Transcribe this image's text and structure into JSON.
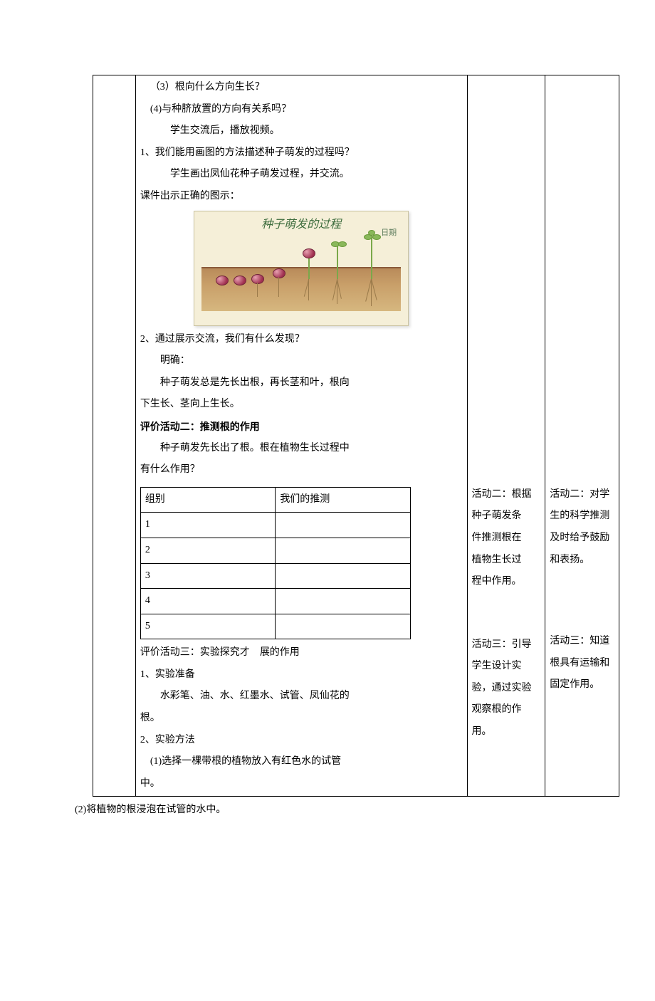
{
  "mid_top": {
    "q3": "（3）根向什么方向生长？",
    "q4": "(4)与种脐放置的方向有关系吗？",
    "line_a": "学生交流后，播放视频。",
    "num1": "1、我们能用画图的方法描述种子萌发的过程吗？",
    "line_b": "学生画出凤仙花种子萌发过程，并交流。",
    "line_c": "课件出示正确的图示：",
    "illus_title": "种子萌发的过程",
    "illus_date": "日期",
    "num2": "2、通过展示交流，我们有什么发现？",
    "line_d": "明确：",
    "line_e": "种子萌发总是先长出根，再长茎和叶，根向",
    "line_f": "下生长、茎向上生长。",
    "heading2": "评价活动二：推测根的作用",
    "line_g": "种子萌发先长出了根。根在植物生长过程中",
    "line_h": "有什么作用？"
  },
  "inner_table": {
    "head_a": "组别",
    "head_b": "我们的推测",
    "rows": [
      "1",
      "2",
      "3",
      "4",
      "5"
    ]
  },
  "mid_bottom": {
    "heading3": "评价活动三：实验探究才",
    "heading3b": "展的作用",
    "s1": "1、实验准备",
    "s1a": "水彩笔、油、水、红墨水、试管、凤仙花的",
    "s1b": "根。",
    "s2": "2、实验方法",
    "s2a": "(1)选择一棵带根的植物放入有红色水的试管",
    "s2b": "中。"
  },
  "r1": {
    "a2_l1": "活动二：根据",
    "a2_l2": "种子萌发条",
    "a2_l3": "件推测根在",
    "a2_l4": "植物生长过",
    "a2_l5": "程中作用。",
    "a3_l1": "活动三：引导",
    "a3_l2": "学生设计实",
    "a3_l3": "验，通过实验",
    "a3_l4": "观察根的作",
    "a3_l5": "用。"
  },
  "r2": {
    "a2_l1": "活动二：对学",
    "a2_l2": "生的科学推测",
    "a2_l3": "及时给予鼓励",
    "a2_l4": "和表扬。",
    "a3_l1": "活动三：知道",
    "a3_l2": "根具有运输和",
    "a3_l3": "固定作用。"
  },
  "below": "(2)将植物的根浸泡在试管的水中。"
}
